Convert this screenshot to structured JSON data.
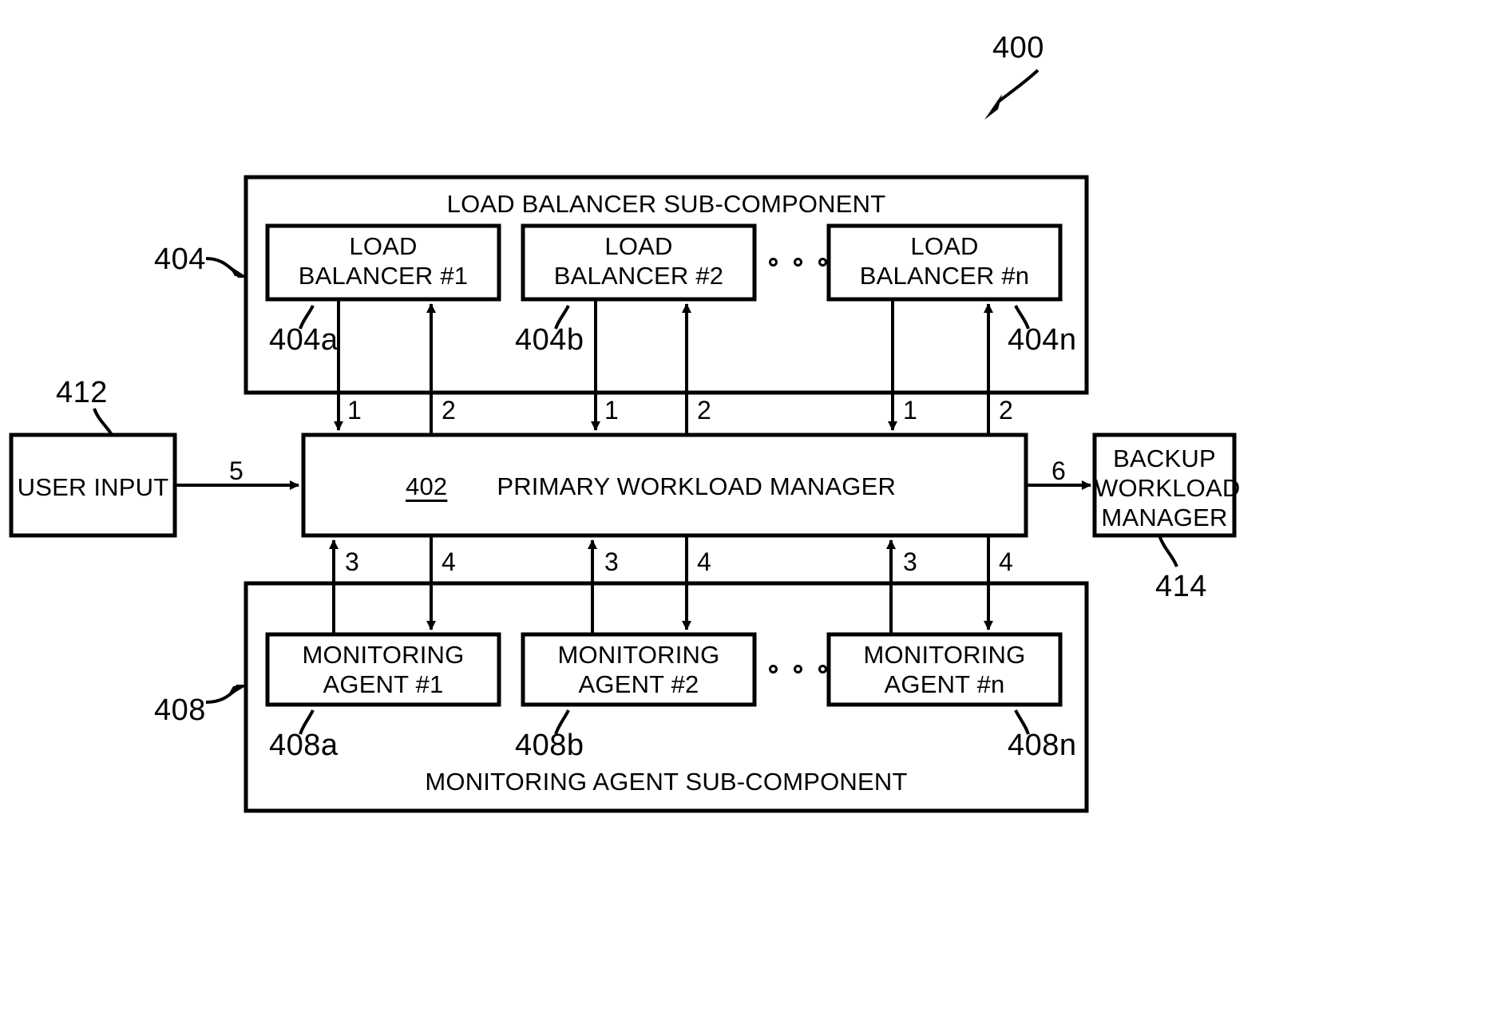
{
  "figure": {
    "figure_number": "400"
  },
  "load_balancer_section": {
    "ref": "404",
    "title": "LOAD BALANCER SUB-COMPONENT",
    "ellipsis": "o o o",
    "items": [
      {
        "line1": "LOAD",
        "line2": "BALANCER #1",
        "ref": "404a"
      },
      {
        "line1": "LOAD",
        "line2": "BALANCER #2",
        "ref": "404b"
      },
      {
        "line1": "LOAD",
        "line2": "BALANCER #n",
        "ref": "404n"
      }
    ]
  },
  "primary_manager": {
    "ref": "402",
    "label": "PRIMARY WORKLOAD MANAGER"
  },
  "user_input": {
    "ref": "412",
    "label": "USER INPUT"
  },
  "backup_manager": {
    "ref": "414",
    "line1": "BACKUP",
    "line2": "WORKLOAD",
    "line3": "MANAGER"
  },
  "monitoring_section": {
    "ref": "408",
    "title": "MONITORING AGENT SUB-COMPONENT",
    "ellipsis": "o o o",
    "items": [
      {
        "line1": "MONITORING",
        "line2": "AGENT #1",
        "ref": "408a"
      },
      {
        "line1": "MONITORING",
        "line2": "AGENT #2",
        "ref": "408b"
      },
      {
        "line1": "MONITORING",
        "line2": "AGENT #n",
        "ref": "408n"
      }
    ]
  },
  "flows": {
    "lb_down": [
      "1",
      "1",
      "1"
    ],
    "lb_up": [
      "2",
      "2",
      "2"
    ],
    "agent_up": [
      "3",
      "3",
      "3"
    ],
    "agent_down": [
      "4",
      "4",
      "4"
    ],
    "user_input_to_manager": "5",
    "manager_to_backup": "6"
  },
  "colors": {
    "stroke": "#000000",
    "background": "#ffffff"
  }
}
